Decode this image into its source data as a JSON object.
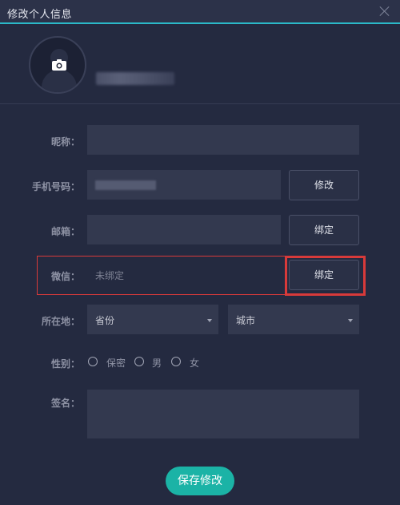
{
  "window": {
    "title": "修改个人信息"
  },
  "labels": {
    "nickname": "昵称：",
    "phone": "手机号码：",
    "email": "邮箱：",
    "wechat": "微信：",
    "location": "所在地：",
    "gender": "性别：",
    "signature": "签名："
  },
  "fields": {
    "nickname": "",
    "email": "",
    "wechat_placeholder": "未绑定",
    "signature": ""
  },
  "buttons": {
    "phone_modify": "修改",
    "email_bind": "绑定",
    "wechat_bind": "绑定",
    "save": "保存修改"
  },
  "location": {
    "province": "省份",
    "city": "城市"
  },
  "gender_options": [
    "保密",
    "男",
    "女"
  ],
  "colors": {
    "background": "#242a40",
    "accent": "#2bb8c8",
    "save_button": "#1bb3a6",
    "highlight": "#d83a3a"
  }
}
